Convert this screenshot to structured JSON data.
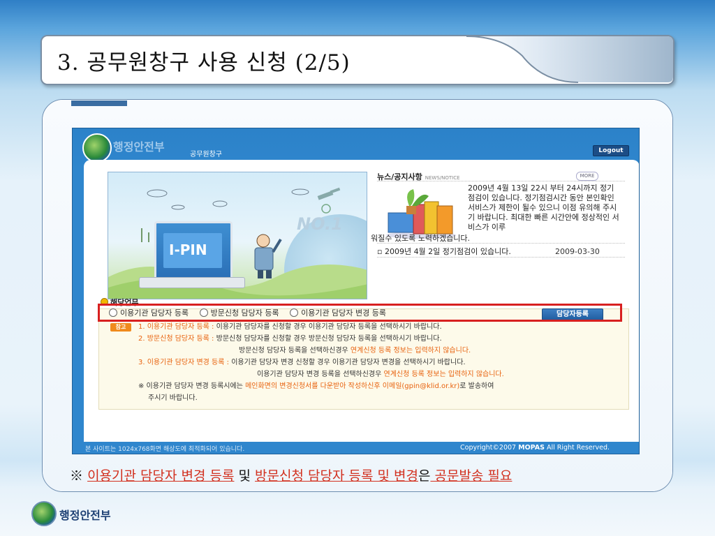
{
  "slide": {
    "title": "3. 공무원창구 사용 신청 (2/5)",
    "brand": "행정안전부"
  },
  "screenshot": {
    "logo_text": "행정안전부",
    "site_name": "공무원창구",
    "logout_label": "Logout",
    "illustration": {
      "monitor_text": "I-PIN",
      "badge_text": "NO.1"
    },
    "news": {
      "title": "뉴스/공지사항",
      "title_en": "NEWS/NOTICE",
      "more_label": "MORE",
      "featured_text": "2009년 4월 13일 22시 부터 24시까지 정기 점검이 있습니다. 정기점검시간 동안 본인확인 서비스가 제한이 될수 있으니 이점 유의해 주시기 바랍니다. 최대한 빠른 시간안에 정상적인 서비스가 이루",
      "featured_tail": "워질수 있도록 노력하겠습니다.",
      "items": [
        {
          "text": "2009년 4월 2일 정기점검이 있습니다.",
          "date": "2009-03-30"
        }
      ]
    },
    "duty": {
      "title": "해당업무",
      "options": [
        "이용기관 담당자 등록",
        "방문신청 담당자 등록",
        "이용기관 담당자 변경 등록"
      ],
      "register_button": "담당자등록",
      "ref_badge": "참고",
      "notes": {
        "n1_head": "1. 이용기관 담당자 등록 :",
        "n1_body": " 이용기관 담당자를 신청할 경우 이용기관 담당자 등록을 선택하시기 바랍니다.",
        "n2_head": "2. 방문신청 담당자 등록 :",
        "n2_body": " 방문신청 담당자를 신청할 경우 방문신청 담당자 등록을 선택하시기 바랍니다.",
        "n2b_body": "방문신청 담당자 등록을 선택하신경우 ",
        "n2b_red": "연계신청 등록 정보는 입력하지 않습니다.",
        "n3_head": "3. 이용기관 담당자 변경 등록 :",
        "n3_body": " 이용기관 담당자 변경 신청할 경우 이용기관 담당자 변경을 선택하시기 바랍니다.",
        "n3b_body": "이용기관 담당자 변경 등록을 선택하신경우 ",
        "n3b_red": "연계신청 등록 정보는 입력하지 않습니다.",
        "n4_body": "※ 이용기관 담당자 변경 등록시에는 ",
        "n4_red": "메인화면의 변경신청서를 다운받아 작성하신후 이메일(gpin@klid.or.kr)",
        "n4_tail": "로 발송하여",
        "n4b_body": "주시기 바랍니다."
      }
    },
    "footer": {
      "left": "본 사이트는 1024x768화면 해상도에 최적화되어 있습니다.",
      "right_pre": "Copyright©2007 ",
      "right_brand": "MOPAS",
      "right_post": "  All Right Reserved."
    }
  },
  "caption": {
    "mark": "※",
    "part1": "이용기관 담당자 변경 등록",
    "conj1": " 및 ",
    "part2": "방문신청 담당자 등록 및 변경",
    "conj2": "은",
    "part3": " 공문발송 필요"
  },
  "colors": {
    "accent_red": "#d2301f",
    "header_blue": "#2f86cd",
    "orange": "#e8620e"
  }
}
